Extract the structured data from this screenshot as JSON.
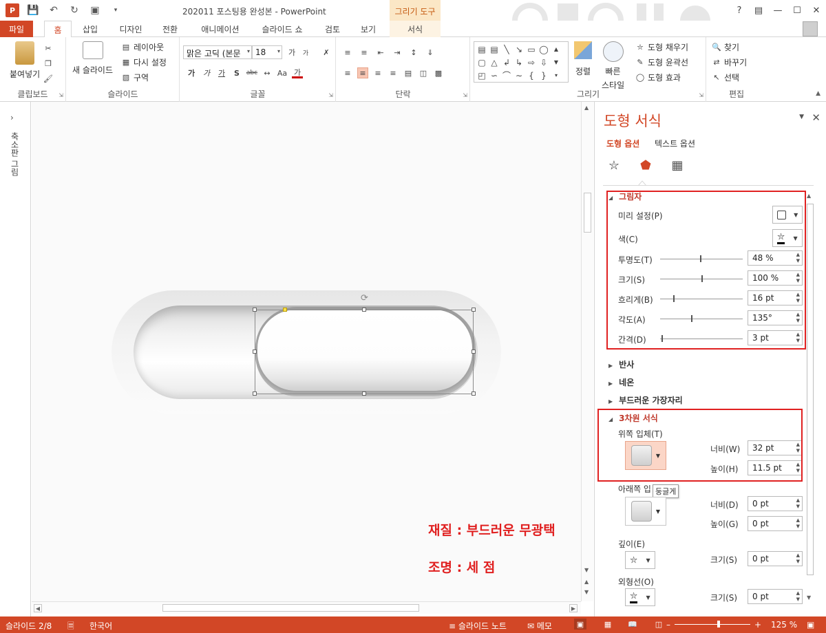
{
  "titlebar": {
    "title": "202011 포스팅용 완성본 - PowerPoint",
    "context_tool": "그리기 도구",
    "help": "?",
    "logo": "P"
  },
  "tabs": {
    "file": "파일",
    "home": "홈",
    "insert": "삽입",
    "design": "디자인",
    "transitions": "전환",
    "animations": "애니메이션",
    "slideshow": "슬라이드 쇼",
    "review": "검토",
    "view": "보기",
    "format": "서식"
  },
  "ribbon": {
    "clipboard": {
      "paste": "붙여넣기",
      "label": "클립보드"
    },
    "slides": {
      "new_slide": "새 슬라이드",
      "layout": "레이아웃",
      "reset": "다시 설정",
      "section": "구역",
      "label": "슬라이드"
    },
    "font": {
      "font_name": "맑은 고딕 (본문",
      "font_size": "18",
      "label": "글꼴"
    },
    "paragraph": {
      "label": "단락"
    },
    "drawing": {
      "arrange": "정렬",
      "quick_styles": "빠른",
      "quick_styles2": "스타일",
      "fill": "도형 채우기",
      "outline": "도형 윤곽선",
      "effects": "도형 효과",
      "label": "그리기"
    },
    "editing": {
      "find": "찾기",
      "replace": "바꾸기",
      "select": "선택",
      "label": "편집"
    }
  },
  "left_panel": {
    "label": "축소판 그림"
  },
  "slide": {
    "note_material": "재질 : 부드러운 무광택",
    "note_lighting": "조명 : 세 점"
  },
  "format_pane": {
    "title": "도형 서식",
    "tab_shape": "도형 옵션",
    "tab_text": "텍스트 옵션",
    "shadow": {
      "title": "그림자",
      "preset": "미리 설정(P)",
      "color": "색(C)",
      "transparency_label": "투명도(T)",
      "transparency": "48 %",
      "size_label": "크기(S)",
      "size": "100 %",
      "blur_label": "흐리게(B)",
      "blur": "16 pt",
      "angle_label": "각도(A)",
      "angle": "135°",
      "distance_label": "간격(D)",
      "distance": "3 pt"
    },
    "reflection": "반사",
    "glow": "네온",
    "soft_edges": "부드러운 가장자리",
    "format3d": {
      "title": "3차원 서식",
      "top_bevel": "위쪽 입체(T)",
      "top_width_label": "너비(W)",
      "top_width": "32 pt",
      "top_height_label": "높이(H)",
      "top_height": "11.5 pt",
      "tooltip": "둥글게",
      "bottom_bevel": "아래쪽 입",
      "bottom_width_label": "너비(D)",
      "bottom_width": "0 pt",
      "bottom_height_label": "높이(G)",
      "bottom_height": "0 pt",
      "depth": "깊이(E)",
      "depth_size_label": "크기(S)",
      "depth_size": "0 pt",
      "contour": "외형선(O)",
      "contour_size_label": "크기(S)",
      "contour_size": "0 pt"
    }
  },
  "statusbar": {
    "slide": "슬라이드 2/8",
    "language": "한국어",
    "notes": "슬라이드 노트",
    "comments": "메모",
    "zoom": "125 %"
  },
  "colors": {
    "accent": "#d24726",
    "highlight": "#e02020"
  }
}
